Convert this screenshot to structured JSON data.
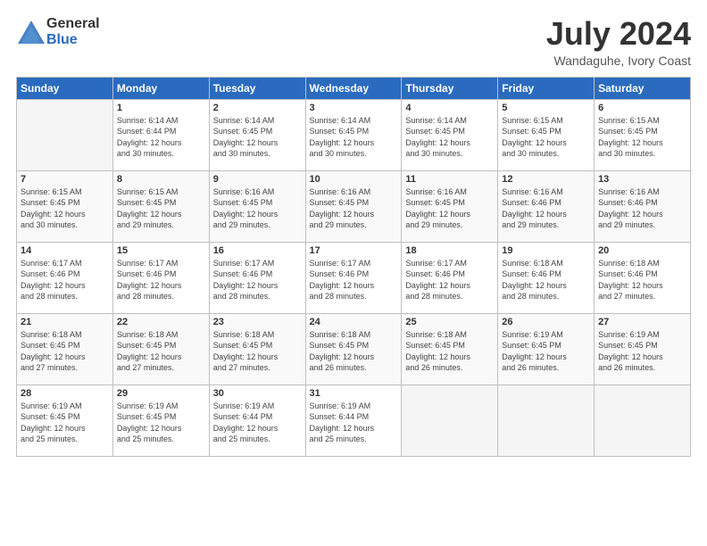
{
  "logo": {
    "general": "General",
    "blue": "Blue"
  },
  "title": {
    "month_year": "July 2024",
    "location": "Wandaguhe, Ivory Coast"
  },
  "days_of_week": [
    "Sunday",
    "Monday",
    "Tuesday",
    "Wednesday",
    "Thursday",
    "Friday",
    "Saturday"
  ],
  "weeks": [
    [
      {
        "day": "",
        "info": ""
      },
      {
        "day": "1",
        "info": "Sunrise: 6:14 AM\nSunset: 6:44 PM\nDaylight: 12 hours\nand 30 minutes."
      },
      {
        "day": "2",
        "info": "Sunrise: 6:14 AM\nSunset: 6:45 PM\nDaylight: 12 hours\nand 30 minutes."
      },
      {
        "day": "3",
        "info": "Sunrise: 6:14 AM\nSunset: 6:45 PM\nDaylight: 12 hours\nand 30 minutes."
      },
      {
        "day": "4",
        "info": "Sunrise: 6:14 AM\nSunset: 6:45 PM\nDaylight: 12 hours\nand 30 minutes."
      },
      {
        "day": "5",
        "info": "Sunrise: 6:15 AM\nSunset: 6:45 PM\nDaylight: 12 hours\nand 30 minutes."
      },
      {
        "day": "6",
        "info": "Sunrise: 6:15 AM\nSunset: 6:45 PM\nDaylight: 12 hours\nand 30 minutes."
      }
    ],
    [
      {
        "day": "7",
        "info": "Sunrise: 6:15 AM\nSunset: 6:45 PM\nDaylight: 12 hours\nand 30 minutes."
      },
      {
        "day": "8",
        "info": "Sunrise: 6:15 AM\nSunset: 6:45 PM\nDaylight: 12 hours\nand 29 minutes."
      },
      {
        "day": "9",
        "info": "Sunrise: 6:16 AM\nSunset: 6:45 PM\nDaylight: 12 hours\nand 29 minutes."
      },
      {
        "day": "10",
        "info": "Sunrise: 6:16 AM\nSunset: 6:45 PM\nDaylight: 12 hours\nand 29 minutes."
      },
      {
        "day": "11",
        "info": "Sunrise: 6:16 AM\nSunset: 6:45 PM\nDaylight: 12 hours\nand 29 minutes."
      },
      {
        "day": "12",
        "info": "Sunrise: 6:16 AM\nSunset: 6:46 PM\nDaylight: 12 hours\nand 29 minutes."
      },
      {
        "day": "13",
        "info": "Sunrise: 6:16 AM\nSunset: 6:46 PM\nDaylight: 12 hours\nand 29 minutes."
      }
    ],
    [
      {
        "day": "14",
        "info": "Sunrise: 6:17 AM\nSunset: 6:46 PM\nDaylight: 12 hours\nand 28 minutes."
      },
      {
        "day": "15",
        "info": "Sunrise: 6:17 AM\nSunset: 6:46 PM\nDaylight: 12 hours\nand 28 minutes."
      },
      {
        "day": "16",
        "info": "Sunrise: 6:17 AM\nSunset: 6:46 PM\nDaylight: 12 hours\nand 28 minutes."
      },
      {
        "day": "17",
        "info": "Sunrise: 6:17 AM\nSunset: 6:46 PM\nDaylight: 12 hours\nand 28 minutes."
      },
      {
        "day": "18",
        "info": "Sunrise: 6:17 AM\nSunset: 6:46 PM\nDaylight: 12 hours\nand 28 minutes."
      },
      {
        "day": "19",
        "info": "Sunrise: 6:18 AM\nSunset: 6:46 PM\nDaylight: 12 hours\nand 28 minutes."
      },
      {
        "day": "20",
        "info": "Sunrise: 6:18 AM\nSunset: 6:46 PM\nDaylight: 12 hours\nand 27 minutes."
      }
    ],
    [
      {
        "day": "21",
        "info": "Sunrise: 6:18 AM\nSunset: 6:45 PM\nDaylight: 12 hours\nand 27 minutes."
      },
      {
        "day": "22",
        "info": "Sunrise: 6:18 AM\nSunset: 6:45 PM\nDaylight: 12 hours\nand 27 minutes."
      },
      {
        "day": "23",
        "info": "Sunrise: 6:18 AM\nSunset: 6:45 PM\nDaylight: 12 hours\nand 27 minutes."
      },
      {
        "day": "24",
        "info": "Sunrise: 6:18 AM\nSunset: 6:45 PM\nDaylight: 12 hours\nand 26 minutes."
      },
      {
        "day": "25",
        "info": "Sunrise: 6:18 AM\nSunset: 6:45 PM\nDaylight: 12 hours\nand 26 minutes."
      },
      {
        "day": "26",
        "info": "Sunrise: 6:19 AM\nSunset: 6:45 PM\nDaylight: 12 hours\nand 26 minutes."
      },
      {
        "day": "27",
        "info": "Sunrise: 6:19 AM\nSunset: 6:45 PM\nDaylight: 12 hours\nand 26 minutes."
      }
    ],
    [
      {
        "day": "28",
        "info": "Sunrise: 6:19 AM\nSunset: 6:45 PM\nDaylight: 12 hours\nand 25 minutes."
      },
      {
        "day": "29",
        "info": "Sunrise: 6:19 AM\nSunset: 6:45 PM\nDaylight: 12 hours\nand 25 minutes."
      },
      {
        "day": "30",
        "info": "Sunrise: 6:19 AM\nSunset: 6:44 PM\nDaylight: 12 hours\nand 25 minutes."
      },
      {
        "day": "31",
        "info": "Sunrise: 6:19 AM\nSunset: 6:44 PM\nDaylight: 12 hours\nand 25 minutes."
      },
      {
        "day": "",
        "info": ""
      },
      {
        "day": "",
        "info": ""
      },
      {
        "day": "",
        "info": ""
      }
    ]
  ]
}
